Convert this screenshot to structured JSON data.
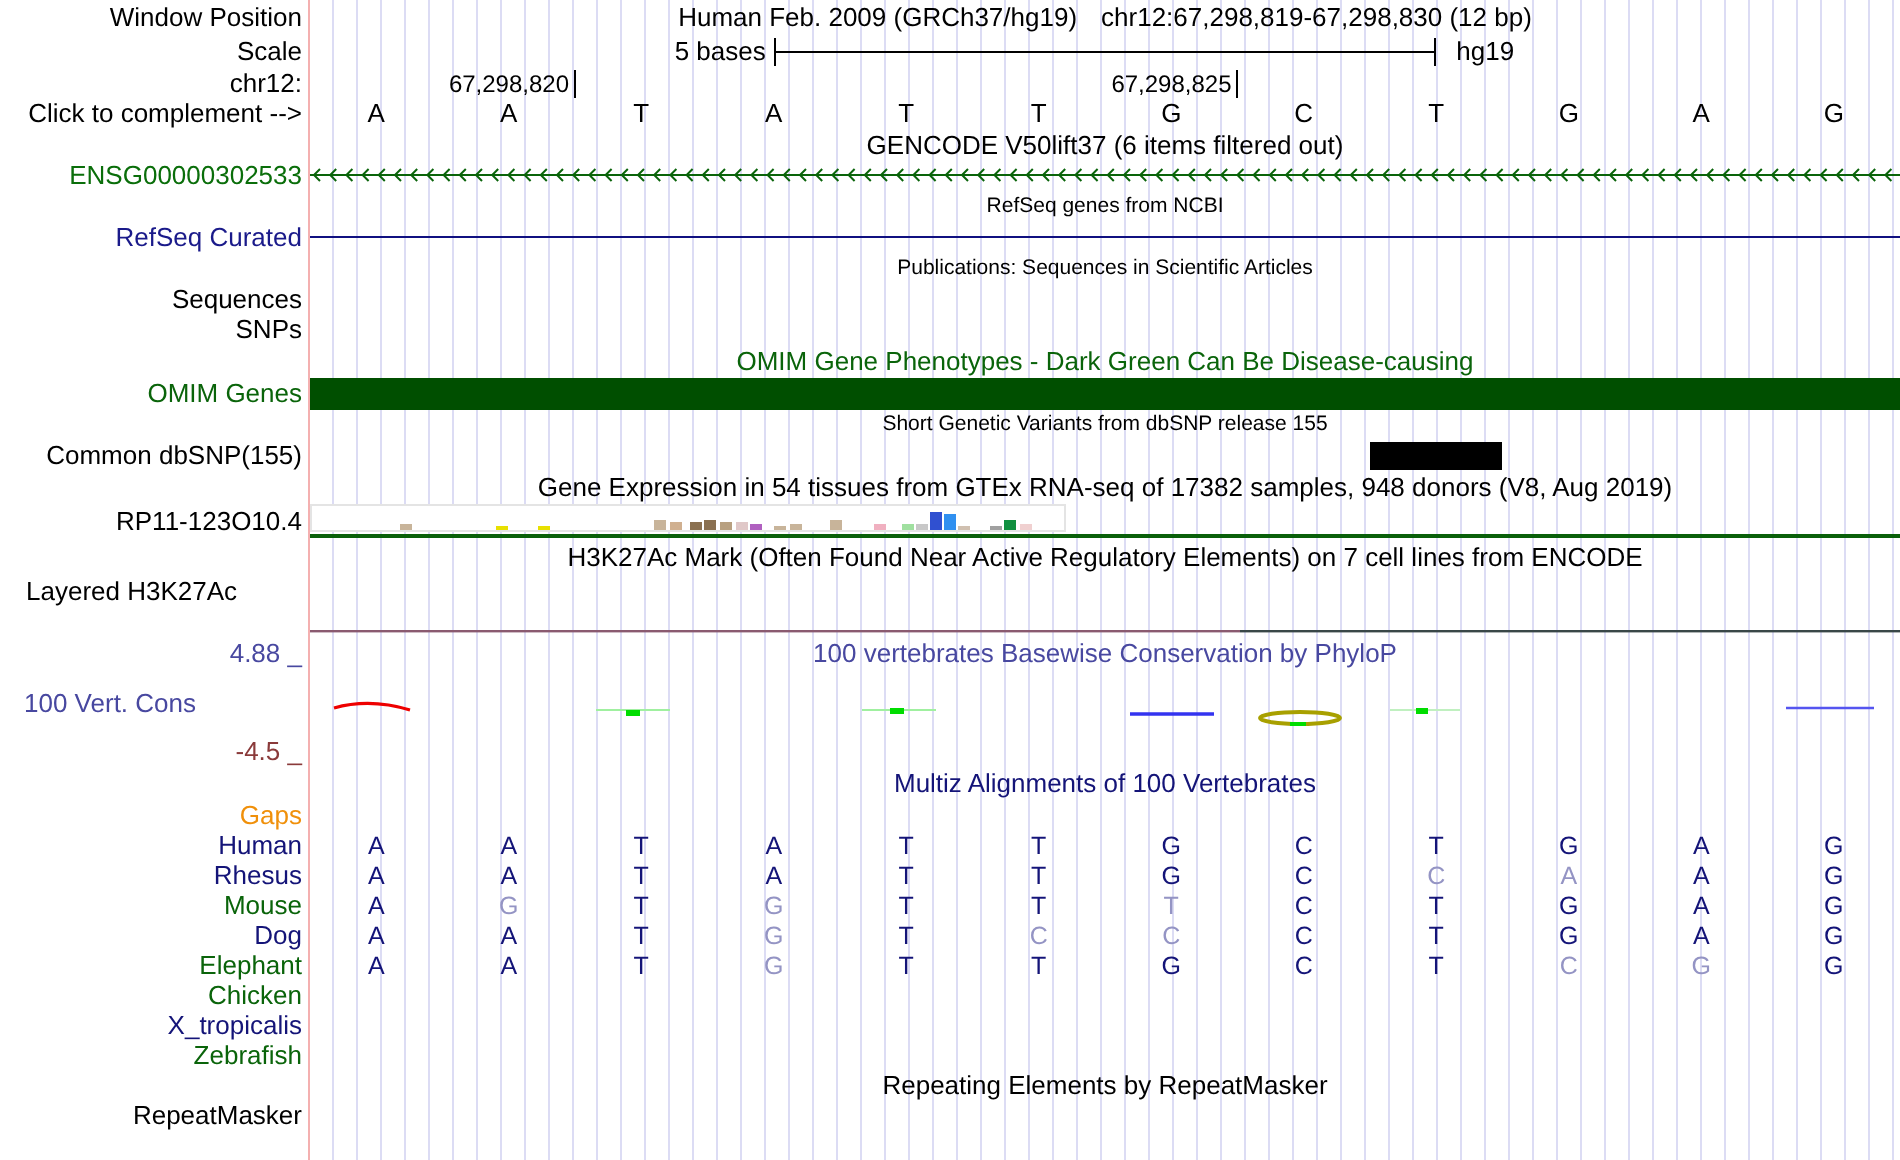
{
  "header": {
    "label": "Window Position",
    "assembly": "Human Feb. 2009 (GRCh37/hg19)",
    "position": "chr12:67,298,819-67,298,830 (12 bp)"
  },
  "scale": {
    "label": "Scale",
    "size": "5 bases",
    "assembly": "hg19"
  },
  "ruler": {
    "label": "chr12:",
    "ticks": [
      "67,298,820",
      "67,298,825"
    ]
  },
  "sequence": {
    "label": "Click to complement -->",
    "bases": [
      "A",
      "A",
      "T",
      "A",
      "T",
      "T",
      "G",
      "C",
      "T",
      "G",
      "A",
      "G"
    ]
  },
  "tracks": [
    {
      "kind": "gencode",
      "title": "GENCODE V50lift37 (6 items filtered out)",
      "label": "ENSG00000302533"
    },
    {
      "kind": "refseq",
      "title": "RefSeq genes from NCBI",
      "label": "RefSeq Curated"
    },
    {
      "kind": "publications",
      "title": "Publications: Sequences in Scientific Articles",
      "labels": [
        "Sequences",
        "SNPs"
      ]
    },
    {
      "kind": "omim",
      "title": "OMIM Gene Phenotypes - Dark Green Can Be Disease-causing",
      "label": "OMIM Genes"
    },
    {
      "kind": "dbsnp",
      "title": "Short Genetic Variants from dbSNP release 155",
      "label": "Common dbSNP(155)"
    },
    {
      "kind": "gtex",
      "title": "Gene Expression in 54 tissues from GTEx RNA-seq of 17382 samples, 948 donors (V8, Aug 2019)",
      "label": "RP11-123O10.4"
    },
    {
      "kind": "h3k27ac",
      "title": "H3K27Ac Mark (Often Found Near Active Regulatory Elements) on 7 cell lines from ENCODE",
      "label": "Layered H3K27Ac"
    },
    {
      "kind": "phylop",
      "title": "100 vertebrates Basewise Conservation by PhyloP",
      "label": "100 Vert. Cons",
      "axis_max": "4.88 _",
      "axis_min": "-4.5 _"
    },
    {
      "kind": "multiz",
      "title": "Multiz Alignments of 100 Vertebrates",
      "gaps_label": "Gaps",
      "species": [
        {
          "name": "Human",
          "color": "#141478",
          "bases": [
            "A",
            "A",
            "T",
            "A",
            "T",
            "T",
            "G",
            "C",
            "T",
            "G",
            "A",
            "G"
          ],
          "matches": [
            true,
            true,
            true,
            true,
            true,
            true,
            true,
            true,
            true,
            true,
            true,
            true
          ]
        },
        {
          "name": "Rhesus",
          "color": "#141478",
          "bases": [
            "A",
            "A",
            "T",
            "A",
            "T",
            "T",
            "G",
            "C",
            "C",
            "A",
            "A",
            "G"
          ],
          "matches": [
            true,
            true,
            true,
            true,
            true,
            true,
            true,
            true,
            false,
            false,
            true,
            true
          ]
        },
        {
          "name": "Mouse",
          "color": "#0a640a",
          "bases": [
            "A",
            "G",
            "T",
            "G",
            "T",
            "T",
            "T",
            "C",
            "T",
            "G",
            "A",
            "G"
          ],
          "matches": [
            true,
            false,
            true,
            false,
            true,
            true,
            false,
            true,
            true,
            true,
            true,
            true
          ]
        },
        {
          "name": "Dog",
          "color": "#141478",
          "bases": [
            "A",
            "A",
            "T",
            "G",
            "T",
            "C",
            "C",
            "C",
            "T",
            "G",
            "A",
            "G"
          ],
          "matches": [
            true,
            true,
            true,
            false,
            true,
            false,
            false,
            true,
            true,
            true,
            true,
            true
          ]
        },
        {
          "name": "Elephant",
          "color": "#0a640a",
          "bases": [
            "A",
            "A",
            "T",
            "G",
            "T",
            "T",
            "G",
            "C",
            "T",
            "C",
            "G",
            "G"
          ],
          "matches": [
            true,
            true,
            true,
            false,
            true,
            true,
            true,
            true,
            true,
            false,
            false,
            true
          ]
        },
        {
          "name": "Chicken",
          "color": "#0a640a"
        },
        {
          "name": "X_tropicalis",
          "color": "#141478"
        },
        {
          "name": "Zebrafish",
          "color": "#0a640a"
        }
      ]
    },
    {
      "kind": "repeatmasker",
      "title": "Repeating Elements by RepeatMasker",
      "label": "RepeatMasker"
    }
  ]
}
